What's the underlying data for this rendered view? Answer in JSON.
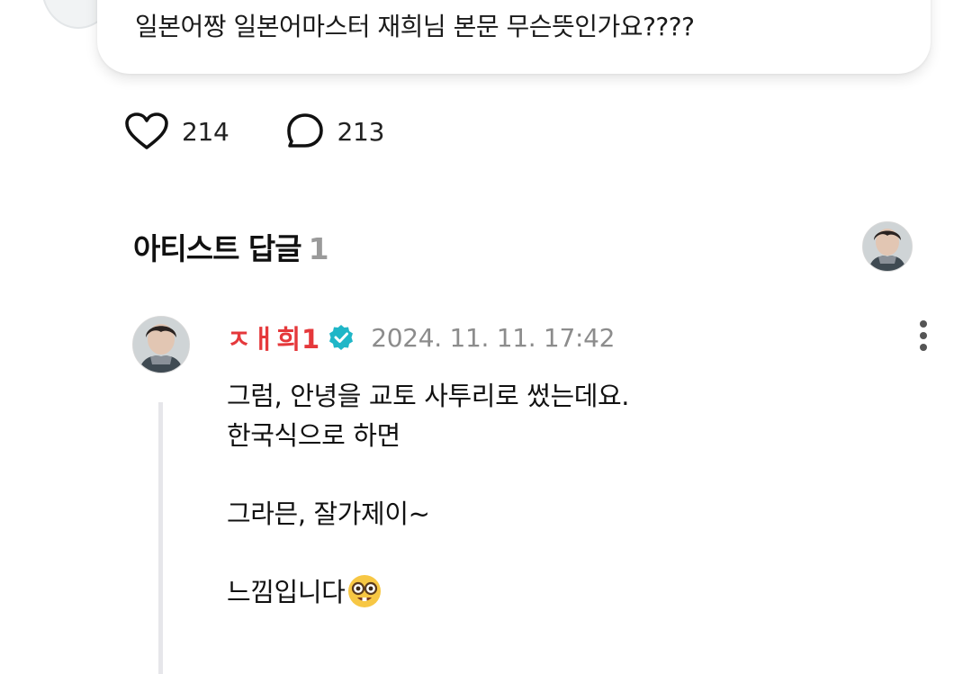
{
  "top_comment": {
    "text": "일본어짱 일본어마스터 재희님 본문 무슨뜻인가요????"
  },
  "reactions": {
    "likes": "214",
    "comments": "213",
    "like_icon": "heart-outline-icon",
    "comment_icon": "chat-bubble-outline-icon"
  },
  "artist_replies": {
    "title": "아티스트 답글",
    "count": "1"
  },
  "reply": {
    "author": "ㅈㅐ희1",
    "verified_icon": "verified-badge-icon",
    "timestamp": "2024. 11. 11. 17:42",
    "lines": [
      "그럼, 안녕을 교토 사투리로 썼는데요.",
      "한국식으로 하면",
      "",
      "그라믄, 잘가제이~",
      "",
      "느낌입니다"
    ],
    "emoji": "nerd-face-emoji"
  },
  "colors": {
    "author": "#e5383b",
    "verified": "#1fb6c7",
    "timestamp": "#8c8c8c",
    "count_muted": "#9a9a9a",
    "thread_line": "#e6e6ea"
  }
}
